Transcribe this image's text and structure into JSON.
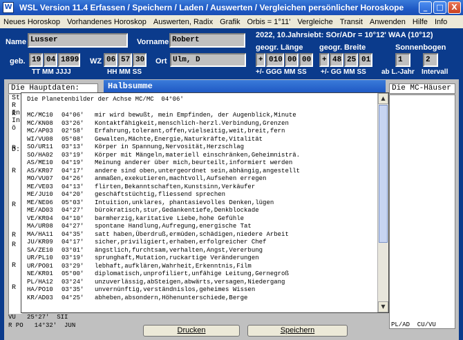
{
  "window": {
    "icon_label": "W",
    "title": "WSL Version 11.4    Erfassen / Speichern / Laden / Auswerten / Vergleichen persönlicher Horoskope",
    "min": "_",
    "max": "□",
    "close": "X"
  },
  "menu": [
    "Neues Horoskop",
    "Vorhandenes Horoskop",
    "Auswerten, Radix",
    "Grafik",
    "Orbis = 1°11'",
    "Vergleiche",
    "Transit",
    "Anwenden",
    "Hilfe",
    "Info"
  ],
  "header": {
    "name_label": "Name",
    "name_value": "Lusser",
    "vorname_label": "Vorname",
    "vorname_value": "Robert",
    "year_info": "2022, 10.Jahrsiebt: SOr/ADr = 10°12' WAA (10°12)",
    "geb_label": "geb.",
    "geb_day": "19",
    "geb_month": "04",
    "geb_year": "1899",
    "geb_sub": "TT MM  JJJJ",
    "wz_label": "WZ",
    "wz_h": "06",
    "wz_m": "57",
    "wz_s": "30",
    "wz_sub": "HH MM SS",
    "ort_label": "Ort",
    "ort_value": "Ulm, D",
    "laenge_label": "geogr. Länge",
    "laenge_sign": "+",
    "laenge_g": "010",
    "laenge_m": "00",
    "laenge_s": "00",
    "laenge_sub": "+/-  GGG MM SS",
    "breite_label": "geogr. Breite",
    "breite_sign": "+",
    "breite_g": "48",
    "breite_m": "25",
    "breite_s": "01",
    "breite_sub": "+/- GG MM SS",
    "sonnenbogen_label": "Sonnenbogen",
    "sb_a": "1",
    "sb_b": "2",
    "sb_a_sub": "ab L.-Jahr",
    "sb_b_sub": "Intervall"
  },
  "panes": {
    "hauptdaten": "Die Hauptdaten:",
    "mc_haeuser": "Die MC-Häuser",
    "left_letters": [
      "St",
      "R",
      "In",
      "In",
      "ö",
      "D:"
    ]
  },
  "dialog": {
    "title": "Halbsumme",
    "heading": "Die Planetenbilder der Achse MC/MC  04°06'",
    "rows": [
      {
        "a": "MC/MC10",
        "b": "04°06'",
        "c": "mir wird bewußt, mein Empfinden, der Augenblick,Minute"
      },
      {
        "a": "MC/KN08",
        "b": "03°26'",
        "c": "Kontaktfähigkeit,menschlich-herzl.Verbindung,Grenzen"
      },
      {
        "a": "MC/AP03",
        "b": "02°58'",
        "c": "Erfahrung,tolerant,offen,vielseitig,weit,breit,fern"
      },
      {
        "a": "WI/VU08",
        "b": "05°08'",
        "c": "Gewalten,Mächte,Energie,Naturkräfte,Vitalität"
      },
      {
        "a": "SO/UR11",
        "b": "03°13'",
        "c": "Körper in Spannung,Nervosität,Herzschlag"
      },
      {
        "a": "SO/HA02",
        "b": "03°19'",
        "c": "Körper mit Mängeln,materiell einschränken,Geheimnisträ."
      },
      {
        "a": "AS/ME10",
        "b": "04°19'",
        "c": "Meinung anderer über mich,beurteilt,informiert werden"
      },
      {
        "a": "AS/KR07",
        "b": "04°17'",
        "c": "andere sind oben,untergeordnet sein,abhängig,angestellt"
      },
      {
        "a": "MO/VU07",
        "b": "04°26'",
        "c": "anmaßen,exekutieren,machtvoll,Aufsehen erregen"
      },
      {
        "a": "ME/VE03",
        "b": "04°13'",
        "c": "flirten,Bekanntschaften,Kunstsinn,Verkäufer"
      },
      {
        "a": "ME/JU10",
        "b": "04°20'",
        "c": "geschäftstüchtig,fliessend sprechen"
      },
      {
        "a": "ME/NE06",
        "b": "05°03'",
        "c": "Intuition,unklares, phantasievolles Denken,lügen"
      },
      {
        "a": "ME/AD03",
        "b": "04°27'",
        "c": "bürokratisch,stur,Gedankentiefe,Denkblockade"
      },
      {
        "a": "VE/KR04",
        "b": "04°10'",
        "c": "barmherzig,karitative Liebe,hohe Gefühle"
      },
      {
        "a": "MA/UR08",
        "b": "04°27'",
        "c": "spontane Handlung,Aufregung,energische Tat"
      },
      {
        "a": "MA/HA11",
        "b": "04°35'",
        "c": "satt haben,Überdruß,ermüden,schädigen,niedere Arbeit"
      },
      {
        "a": "JU/KR09",
        "b": "04°17'",
        "c": "sicher,priviligiert,erhaben,erfolgreicher Chef"
      },
      {
        "a": "SA/ZE10",
        "b": "03°01'",
        "c": "ängstlich,furchtsam,verhalten,Angst,Vererbung"
      },
      {
        "a": "UR/PL10",
        "b": "03°19'",
        "c": "sprunghaft,Mutation,ruckartige Veränderungen"
      },
      {
        "a": "UR/PO01",
        "b": "03°29'",
        "c": "lebhaft,aufklären,Wahrheit,Erkenntnis,Film"
      },
      {
        "a": "NE/KR01",
        "b": "05°00'",
        "c": "diplomatisch,unprofiliert,unfähige Leitung,Gernegroß"
      },
      {
        "a": "PL/HA12",
        "b": "03°24'",
        "c": "unzuverlässig,abSteigen,abwärts,versagen,Niedergang"
      },
      {
        "a": "HA/PO10",
        "b": "03°35'",
        "c": "unvernünftig,verständnislos,geheimes Wissen"
      },
      {
        "a": "KR/AD03",
        "b": "04°25'",
        "c": "abheben,absondern,Höhenunterschiede,Berge"
      }
    ],
    "r_markers": [
      "R",
      "R",
      "R",
      "R",
      "R",
      "R",
      "R",
      "R"
    ]
  },
  "bottom": {
    "left_line1": "VU   25°27'  SII",
    "left_line2": "R PO   14°32'  JUN",
    "drucken": "Drucken",
    "speichern": "Speichern",
    "right_text": "PL/AD  CU/VU"
  }
}
